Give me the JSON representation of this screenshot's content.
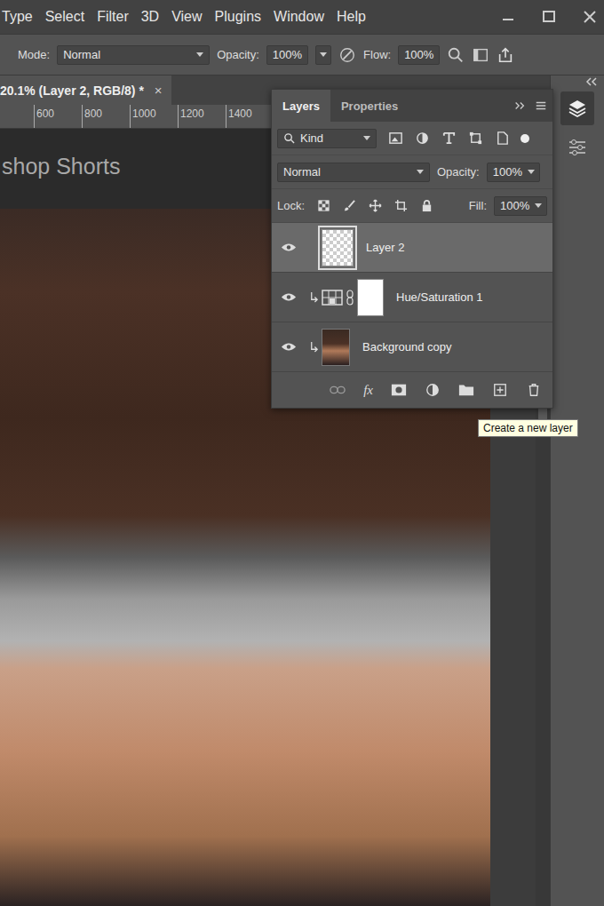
{
  "menu": [
    "Type",
    "Select",
    "Filter",
    "3D",
    "View",
    "Plugins",
    "Window",
    "Help"
  ],
  "options": {
    "modeLabel": "Mode:",
    "mode": "Normal",
    "opacityLabel": "Opacity:",
    "opacity": "100%",
    "flowLabel": "Flow:",
    "flow": "100%"
  },
  "document": {
    "tab": "20.1% (Layer 2, RGB/8) *",
    "close": "×",
    "ruler": [
      "600",
      "800",
      "1000",
      "1200",
      "1400"
    ],
    "canvasTitle": "shop Shorts"
  },
  "layersPanel": {
    "tabs": [
      {
        "label": "Layers",
        "selected": true
      },
      {
        "label": "Properties",
        "selected": false
      }
    ],
    "filter": "Kind",
    "blendMode": "Normal",
    "opacityLabel": "Opacity:",
    "opacity": "100%",
    "lockLabel": "Lock:",
    "fillLabel": "Fill:",
    "fill": "100%",
    "fxLabel": "fx",
    "layers": [
      {
        "name": "Layer 2",
        "kind": "pixel",
        "selected": true,
        "visible": true,
        "clipped": false
      },
      {
        "name": "Hue/Saturation 1",
        "kind": "adjustment",
        "selected": false,
        "visible": true,
        "clipped": true
      },
      {
        "name": "Background copy",
        "kind": "image",
        "selected": false,
        "visible": true,
        "clipped": true
      }
    ]
  },
  "tooltip": "Create a new layer"
}
